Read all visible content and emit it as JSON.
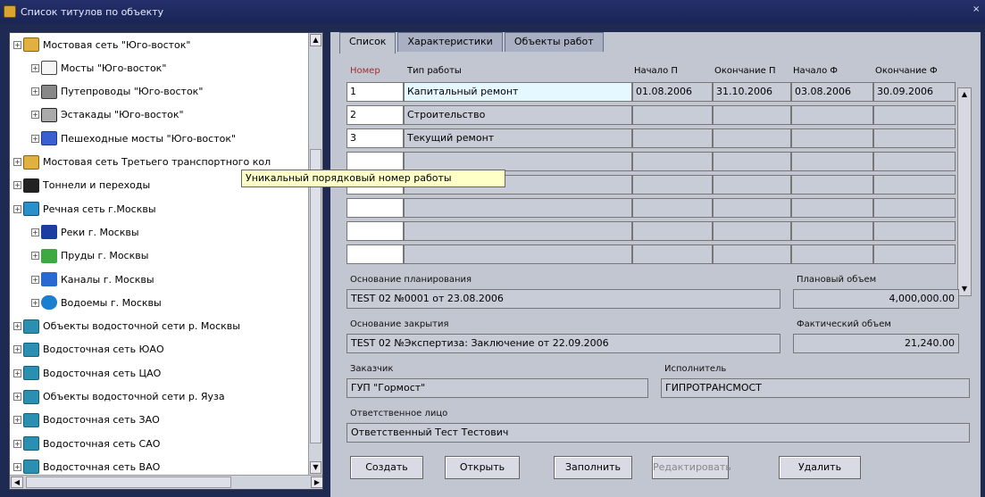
{
  "window": {
    "title": "Список титулов по объекту",
    "close_glyph": "×"
  },
  "tree": {
    "items": [
      {
        "label": "Мостовая сеть \"Юго-восток\"",
        "icon": "bridge-network-icon",
        "level": 0
      },
      {
        "label": "Мосты \"Юго-восток\"",
        "icon": "bridges-icon",
        "level": 1
      },
      {
        "label": "Путепроводы \"Юго-восток\"",
        "icon": "overpass-icon",
        "level": 1
      },
      {
        "label": "Эстакады \"Юго-восток\"",
        "icon": "estacade-icon",
        "level": 1
      },
      {
        "label": "Пешеходные мосты \"Юго-восток\"",
        "icon": "pedestrian-bridge-icon",
        "level": 1
      },
      {
        "label": "Мостовая сеть Третьего транспортного кол",
        "icon": "bridge-network-icon",
        "level": 0
      },
      {
        "label": "Тоннели и переходы",
        "icon": "tunnel-icon",
        "level": 0
      },
      {
        "label": "Речная сеть г.Москвы",
        "icon": "river-network-icon",
        "level": 0
      },
      {
        "label": "Реки г. Москвы",
        "icon": "rivers-icon",
        "level": 1
      },
      {
        "label": "Пруды г. Москвы",
        "icon": "ponds-icon",
        "level": 1
      },
      {
        "label": "Каналы г. Москвы",
        "icon": "canals-icon",
        "level": 1
      },
      {
        "label": "Водоемы г. Москвы",
        "icon": "reservoir-icon",
        "level": 1
      },
      {
        "label": "Объекты водосточной сети р. Москвы",
        "icon": "water-network-icon",
        "level": 0
      },
      {
        "label": "Водосточная сеть ЮАО",
        "icon": "water-network-icon",
        "level": 0
      },
      {
        "label": "Водосточная сеть ЦАО",
        "icon": "water-network-icon",
        "level": 0
      },
      {
        "label": "Объекты водосточной сети р. Яуза",
        "icon": "water-network-icon",
        "level": 0
      },
      {
        "label": "Водосточная сеть ЗАО",
        "icon": "water-network-icon",
        "level": 0
      },
      {
        "label": "Водосточная сеть САО",
        "icon": "water-network-icon",
        "level": 0
      },
      {
        "label": "Водосточная сеть ВАО",
        "icon": "water-network-icon",
        "level": 0
      }
    ]
  },
  "tooltip": "Уникальный порядковый номер работы",
  "tabs": [
    "Список",
    "Характеристики",
    "Объекты работ"
  ],
  "grid": {
    "headers": [
      "Номер",
      "Тип работы",
      "Начало П",
      "Окончание П",
      "Начало Ф",
      "Окончание Ф"
    ],
    "rows": [
      {
        "num": "1",
        "type": "Капитальный ремонт",
        "start_p": "01.08.2006",
        "end_p": "31.10.2006",
        "start_f": "03.08.2006",
        "end_f": "30.09.2006"
      },
      {
        "num": "2",
        "type": "Строительство",
        "start_p": "",
        "end_p": "",
        "start_f": "",
        "end_f": ""
      },
      {
        "num": "3",
        "type": "Текущий ремонт",
        "start_p": "",
        "end_p": "",
        "start_f": "",
        "end_f": ""
      },
      {
        "num": "",
        "type": "",
        "start_p": "",
        "end_p": "",
        "start_f": "",
        "end_f": ""
      },
      {
        "num": "",
        "type": "",
        "start_p": "",
        "end_p": "",
        "start_f": "",
        "end_f": ""
      },
      {
        "num": "",
        "type": "",
        "start_p": "",
        "end_p": "",
        "start_f": "",
        "end_f": ""
      },
      {
        "num": "",
        "type": "",
        "start_p": "",
        "end_p": "",
        "start_f": "",
        "end_f": ""
      },
      {
        "num": "",
        "type": "",
        "start_p": "",
        "end_p": "",
        "start_f": "",
        "end_f": ""
      }
    ]
  },
  "form": {
    "planning_basis_label": "Основание планирования",
    "planning_basis": "TEST 02 №0001 от 23.08.2006",
    "planned_volume_label": "Плановый объем",
    "planned_volume": "4,000,000.00",
    "closing_basis_label": "Основание закрытия",
    "closing_basis": "TEST 02 №Экспертиза: Заключение от 22.09.2006",
    "actual_volume_label": "Фактический объем",
    "actual_volume": "21,240.00",
    "customer_label": "Заказчик",
    "customer": "ГУП \"Гормост\"",
    "contractor_label": "Исполнитель",
    "contractor": "ГИПРОТРАНСМОСТ",
    "responsible_label": "Ответственное лицо",
    "responsible": "Ответственный Тест Тестович"
  },
  "buttons": {
    "create": "Создать",
    "open": "Открыть",
    "fill": "Заполнить",
    "edit": "Редактировать",
    "delete": "Удалить"
  }
}
